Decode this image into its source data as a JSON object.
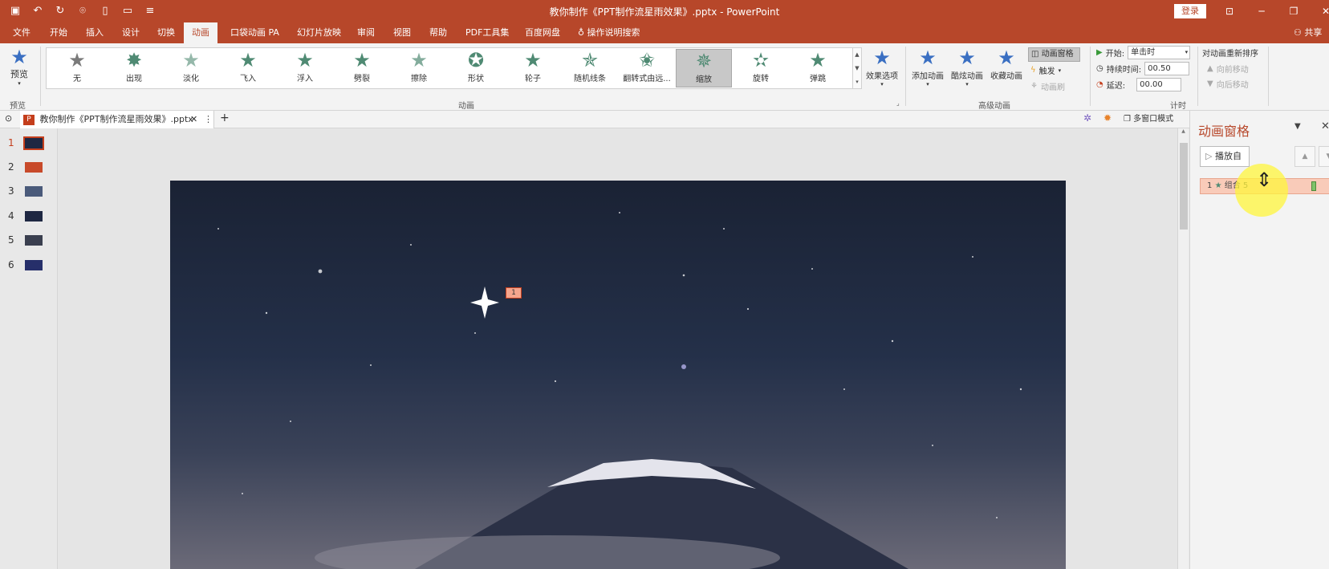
{
  "titlebar": {
    "title": "教你制作《PPT制作流星雨效果》.pptx  -  PowerPoint",
    "login": "登录",
    "qat_icons": [
      "save-icon",
      "undo-icon",
      "redo-icon",
      "presenter-icon",
      "new-file-icon",
      "open-folder-icon",
      "customize-icon"
    ]
  },
  "tabs": [
    "文件",
    "开始",
    "插入",
    "设计",
    "切换",
    "动画",
    "口袋动画 PA",
    "幻灯片放映",
    "审阅",
    "视图",
    "帮助",
    "PDF工具集",
    "百度网盘",
    "操作说明搜索"
  ],
  "active_tab": "动画",
  "share": "共享",
  "ribbon": {
    "preview": "预览",
    "preview_group": "预览",
    "animations": [
      "无",
      "出现",
      "淡化",
      "飞入",
      "浮入",
      "劈裂",
      "擦除",
      "形状",
      "轮子",
      "随机线条",
      "翻转式由远...",
      "缩放",
      "旋转",
      "弹跳"
    ],
    "selected_animation": "缩放",
    "effect_options": "效果选项",
    "animation_group": "动画",
    "add_animation": "添加动画",
    "fancy_animation": "酷炫动画",
    "collect_animation": "收藏动画",
    "animation_pane": "动画窗格",
    "trigger": "触发",
    "anim_painter": "动画刷",
    "advanced_group": "高级动画",
    "start_label": "开始:",
    "start_value": "单击时",
    "duration_label": "持续时间:",
    "duration_value": "00.50",
    "delay_label": "延迟:",
    "delay_value": "00.00",
    "timing_group": "计时",
    "reorder_title": "对动画重新排序",
    "move_earlier": "向前移动",
    "move_later": "向后移动"
  },
  "doc": {
    "tab_name": "教你制作《PPT制作流星雨效果》.pptx",
    "multi_window": "多窗口模式"
  },
  "slides": [
    "1",
    "2",
    "3",
    "4",
    "5",
    "6"
  ],
  "slide_tag": "1",
  "pane": {
    "title": "动画窗格",
    "play_from": "播放自",
    "item": {
      "index": "1",
      "name": "组合 5"
    }
  },
  "colors": {
    "accent": "#b7472a",
    "ribbon": "#f3f3f3",
    "animation_green": "#4f8a73"
  }
}
